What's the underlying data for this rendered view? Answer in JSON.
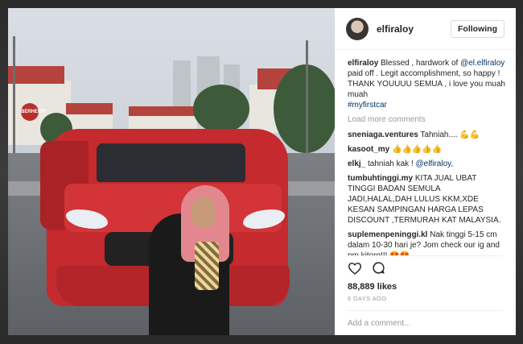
{
  "post": {
    "username": "elfiraloy",
    "follow_label": "Following"
  },
  "scene": {
    "stop_sign_text": "BERHENTI"
  },
  "caption": {
    "user": "elfiraloy",
    "text_before": " Blessed , hardwork of ",
    "mention": "@el.elfiraloy",
    "text_after": " paid off . Legit accomplishment, so happy ! THANK YOUUUU SEMUA , i love you muah muah",
    "hashtag": "#myfirstcar"
  },
  "load_more": "Load more comments",
  "comments": [
    {
      "user": "sneniaga.ventures",
      "text": " Tahniah.... ",
      "emoji": "💪💪"
    },
    {
      "user": "kasoot_my",
      "text": " ",
      "emoji": "👍👍👍👍👍"
    },
    {
      "user": "elkj_",
      "text": " tahniah kak ! ",
      "mention": "@elfiraloy",
      "tail": ","
    },
    {
      "user": "tumbuhtinggi.my",
      "text": " KITA JUAL UBAT TINGGI BADAN SEMULA JADI,HALAL,DAH LULUS KKM,XDE KESAN SAMPINGAN HARGA LEPAS DISCOUNT ,TERMURAH KAT MALAYSIA."
    },
    {
      "user": "suplemenpeninggi.kl",
      "text": " Nak tinggi 5-15 cm dalam 10-30 hari je? Jom check our ig and pm kitorg!!! ",
      "emoji": "😍😍"
    }
  ],
  "actions": {
    "like_icon": "heart-icon",
    "comment_icon": "comment-bubble-icon"
  },
  "likes_text": "88,889 likes",
  "time_ago": "6 DAYS AGO",
  "add_comment_placeholder": "Add a comment..."
}
